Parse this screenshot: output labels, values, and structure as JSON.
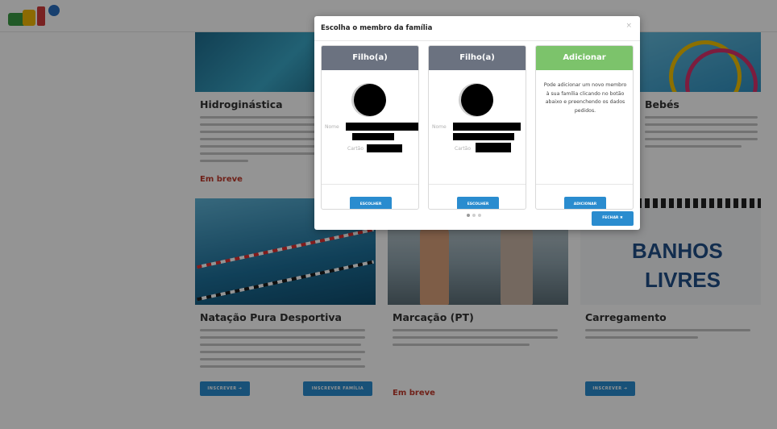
{
  "modal": {
    "title": "Escolha o membro da família",
    "close_icon": "×",
    "members": [
      {
        "header": "Filho(a)",
        "header_color": "#6b7280",
        "name_label": "Nome",
        "card_label": "Cartão",
        "button": "ESCOLHER"
      },
      {
        "header": "Filho(a)",
        "header_color": "#6b7280",
        "name_label": "Nome",
        "card_label": "Cartão",
        "button": "ESCOLHER"
      }
    ],
    "add": {
      "header": "Adicionar",
      "header_color": "#7cc36b",
      "text": "Pode adicionar um novo membro à sua família clicando no botão abaixo e preenchendo os dados pedidos.",
      "button": "ADICIONAR"
    },
    "close_button": "FECHAR ✖"
  },
  "background": {
    "cards": [
      {
        "title": "Hidroginástica",
        "status": "Em breve"
      },
      {
        "title": "Bebés"
      },
      {
        "title": "Natação Pura Desportiva",
        "buttons": [
          "INSCREVER ➔",
          "INSCREVER FAMÍLIA"
        ]
      },
      {
        "title": "Marcação (PT)",
        "status": "Em breve"
      },
      {
        "title": "Carregamento",
        "buttons": [
          "INSCREVER ➔"
        ]
      }
    ],
    "banner_text": [
      "BANHOS",
      "LIVRES"
    ]
  },
  "colors": {
    "accent": "#2a8ccf",
    "status_soon": "#c0392b",
    "add_header": "#7cc36b",
    "member_header": "#6b7280"
  }
}
